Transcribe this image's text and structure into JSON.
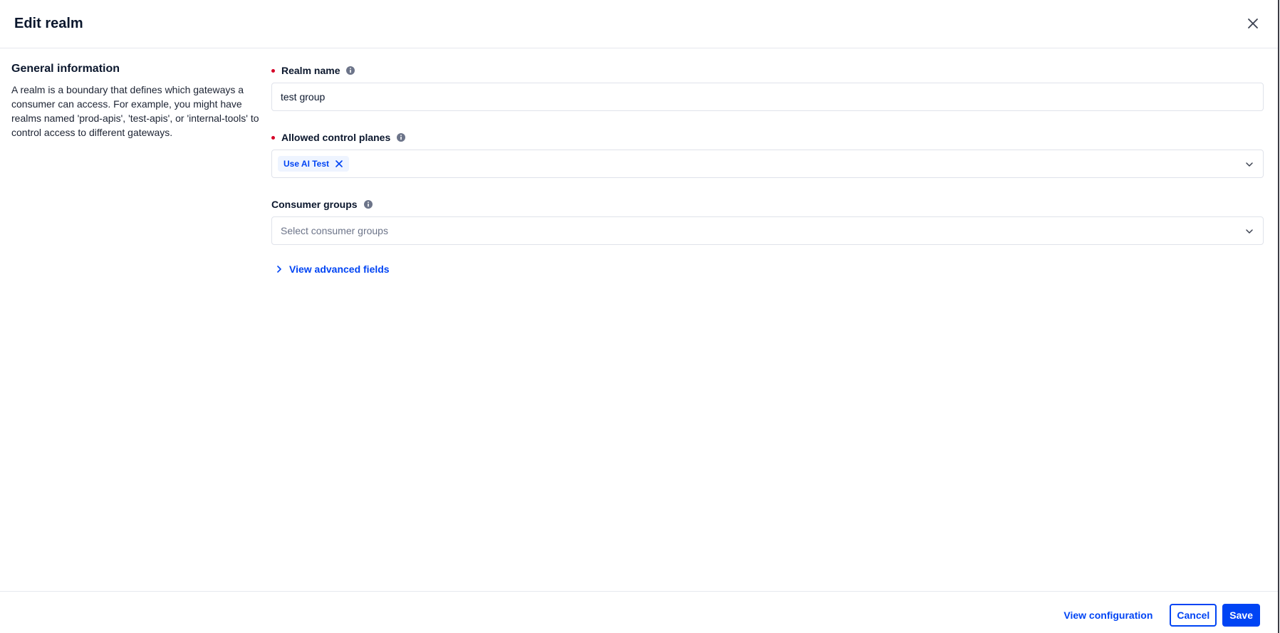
{
  "header": {
    "title": "Edit realm",
    "close_icon": "close-icon"
  },
  "sidebar": {
    "heading": "General information",
    "description": "A realm is a boundary that defines which gateways a consumer can access. For example, you might have realms named 'prod-apis', 'test-apis', or 'internal-tools' to control access to different gateways."
  },
  "form": {
    "realm_name": {
      "label": "Realm name",
      "required": true,
      "value": "test group"
    },
    "allowed_control_planes": {
      "label": "Allowed control planes",
      "required": true,
      "selected": [
        "Use AI Test"
      ]
    },
    "consumer_groups": {
      "label": "Consumer groups",
      "required": false,
      "placeholder": "Select consumer groups"
    },
    "advanced_link": "View advanced fields"
  },
  "footer": {
    "view_configuration": "View configuration",
    "cancel": "Cancel",
    "save": "Save"
  },
  "colors": {
    "accent": "#0044f4",
    "required": "#d60027",
    "chip_bg": "#eef4ff"
  }
}
